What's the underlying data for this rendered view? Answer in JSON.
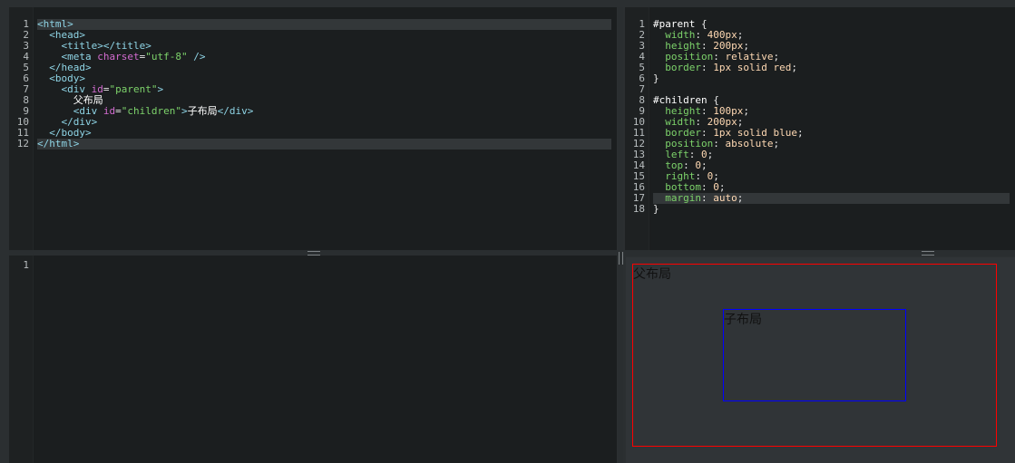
{
  "html_editor": {
    "lines": [
      {
        "n": "1",
        "tokens": [
          [
            "tag",
            "<html>"
          ]
        ]
      },
      {
        "n": "2",
        "tokens": [
          [
            "text",
            "  "
          ],
          [
            "tag",
            "<head>"
          ]
        ]
      },
      {
        "n": "3",
        "tokens": [
          [
            "text",
            "    "
          ],
          [
            "tag",
            "<title></title>"
          ]
        ]
      },
      {
        "n": "4",
        "tokens": [
          [
            "text",
            "    "
          ],
          [
            "tag",
            "<meta "
          ],
          [
            "attr",
            "charset"
          ],
          [
            "punc",
            "="
          ],
          [
            "str",
            "\"utf-8\""
          ],
          [
            "tag",
            " />"
          ]
        ]
      },
      {
        "n": "5",
        "tokens": [
          [
            "text",
            "  "
          ],
          [
            "tag",
            "</head>"
          ]
        ]
      },
      {
        "n": "6",
        "tokens": [
          [
            "text",
            "  "
          ],
          [
            "tag",
            "<body>"
          ]
        ]
      },
      {
        "n": "7",
        "tokens": [
          [
            "text",
            "    "
          ],
          [
            "tag",
            "<div "
          ],
          [
            "attr",
            "id"
          ],
          [
            "punc",
            "="
          ],
          [
            "str",
            "\"parent\""
          ],
          [
            "tag",
            ">"
          ]
        ]
      },
      {
        "n": "8",
        "tokens": [
          [
            "text",
            "      父布局"
          ]
        ]
      },
      {
        "n": "9",
        "tokens": [
          [
            "text",
            "      "
          ],
          [
            "tag",
            "<div "
          ],
          [
            "attr",
            "id"
          ],
          [
            "punc",
            "="
          ],
          [
            "str",
            "\"children\""
          ],
          [
            "tag",
            ">"
          ],
          [
            "text",
            "子布局"
          ],
          [
            "tag",
            "</div>"
          ]
        ]
      },
      {
        "n": "10",
        "tokens": [
          [
            "text",
            "    "
          ],
          [
            "tag",
            "</div>"
          ]
        ]
      },
      {
        "n": "11",
        "tokens": [
          [
            "text",
            "  "
          ],
          [
            "tag",
            "</body>"
          ]
        ]
      },
      {
        "n": "12",
        "tokens": [
          [
            "tag",
            "</html>"
          ]
        ]
      }
    ],
    "active_lines": [
      "1",
      "12"
    ]
  },
  "css_editor": {
    "lines": [
      {
        "n": "1",
        "tokens": [
          [
            "sel",
            "#parent "
          ],
          [
            "punc",
            "{"
          ]
        ]
      },
      {
        "n": "2",
        "tokens": [
          [
            "text",
            "  "
          ],
          [
            "prop",
            "width"
          ],
          [
            "punc",
            ": "
          ],
          [
            "val",
            "400px"
          ],
          [
            "punc",
            ";"
          ]
        ]
      },
      {
        "n": "3",
        "tokens": [
          [
            "text",
            "  "
          ],
          [
            "prop",
            "height"
          ],
          [
            "punc",
            ": "
          ],
          [
            "val",
            "200px"
          ],
          [
            "punc",
            ";"
          ]
        ]
      },
      {
        "n": "4",
        "tokens": [
          [
            "text",
            "  "
          ],
          [
            "prop",
            "position"
          ],
          [
            "punc",
            ": "
          ],
          [
            "val",
            "relative"
          ],
          [
            "punc",
            ";"
          ]
        ]
      },
      {
        "n": "5",
        "tokens": [
          [
            "text",
            "  "
          ],
          [
            "prop",
            "border"
          ],
          [
            "punc",
            ": "
          ],
          [
            "val",
            "1px solid red"
          ],
          [
            "punc",
            ";"
          ]
        ]
      },
      {
        "n": "6",
        "tokens": [
          [
            "punc",
            "}"
          ]
        ]
      },
      {
        "n": "7",
        "tokens": [
          [
            "text",
            ""
          ]
        ]
      },
      {
        "n": "8",
        "tokens": [
          [
            "sel",
            "#children "
          ],
          [
            "punc",
            "{"
          ]
        ]
      },
      {
        "n": "9",
        "tokens": [
          [
            "text",
            "  "
          ],
          [
            "prop",
            "height"
          ],
          [
            "punc",
            ": "
          ],
          [
            "val",
            "100px"
          ],
          [
            "punc",
            ";"
          ]
        ]
      },
      {
        "n": "10",
        "tokens": [
          [
            "text",
            "  "
          ],
          [
            "prop",
            "width"
          ],
          [
            "punc",
            ": "
          ],
          [
            "val",
            "200px"
          ],
          [
            "punc",
            ";"
          ]
        ]
      },
      {
        "n": "11",
        "tokens": [
          [
            "text",
            "  "
          ],
          [
            "prop",
            "border"
          ],
          [
            "punc",
            ": "
          ],
          [
            "val",
            "1px solid blue"
          ],
          [
            "punc",
            ";"
          ]
        ]
      },
      {
        "n": "12",
        "tokens": [
          [
            "text",
            "  "
          ],
          [
            "prop",
            "position"
          ],
          [
            "punc",
            ": "
          ],
          [
            "val",
            "absolute"
          ],
          [
            "punc",
            ";"
          ]
        ]
      },
      {
        "n": "13",
        "tokens": [
          [
            "text",
            "  "
          ],
          [
            "prop",
            "left"
          ],
          [
            "punc",
            ": "
          ],
          [
            "val",
            "0"
          ],
          [
            "punc",
            ";"
          ]
        ]
      },
      {
        "n": "14",
        "tokens": [
          [
            "text",
            "  "
          ],
          [
            "prop",
            "top"
          ],
          [
            "punc",
            ": "
          ],
          [
            "val",
            "0"
          ],
          [
            "punc",
            ";"
          ]
        ]
      },
      {
        "n": "15",
        "tokens": [
          [
            "text",
            "  "
          ],
          [
            "prop",
            "right"
          ],
          [
            "punc",
            ": "
          ],
          [
            "val",
            "0"
          ],
          [
            "punc",
            ";"
          ]
        ]
      },
      {
        "n": "16",
        "tokens": [
          [
            "text",
            "  "
          ],
          [
            "prop",
            "bottom"
          ],
          [
            "punc",
            ": "
          ],
          [
            "val",
            "0"
          ],
          [
            "punc",
            ";"
          ]
        ]
      },
      {
        "n": "17",
        "tokens": [
          [
            "text",
            "  "
          ],
          [
            "prop",
            "margin"
          ],
          [
            "punc",
            ": "
          ],
          [
            "val",
            "auto"
          ],
          [
            "punc",
            ";"
          ]
        ]
      },
      {
        "n": "18",
        "tokens": [
          [
            "punc",
            "}"
          ]
        ]
      }
    ],
    "active_lines": [
      "17"
    ]
  },
  "js_editor": {
    "lines": [
      {
        "n": "1",
        "tokens": [
          [
            "text",
            ""
          ]
        ]
      }
    ],
    "active_lines": [
      "1"
    ]
  },
  "preview": {
    "parent_text": "父布局",
    "children_text": "子布局",
    "parent_border_color": "#ff0000",
    "children_border_color": "#0000ff"
  }
}
